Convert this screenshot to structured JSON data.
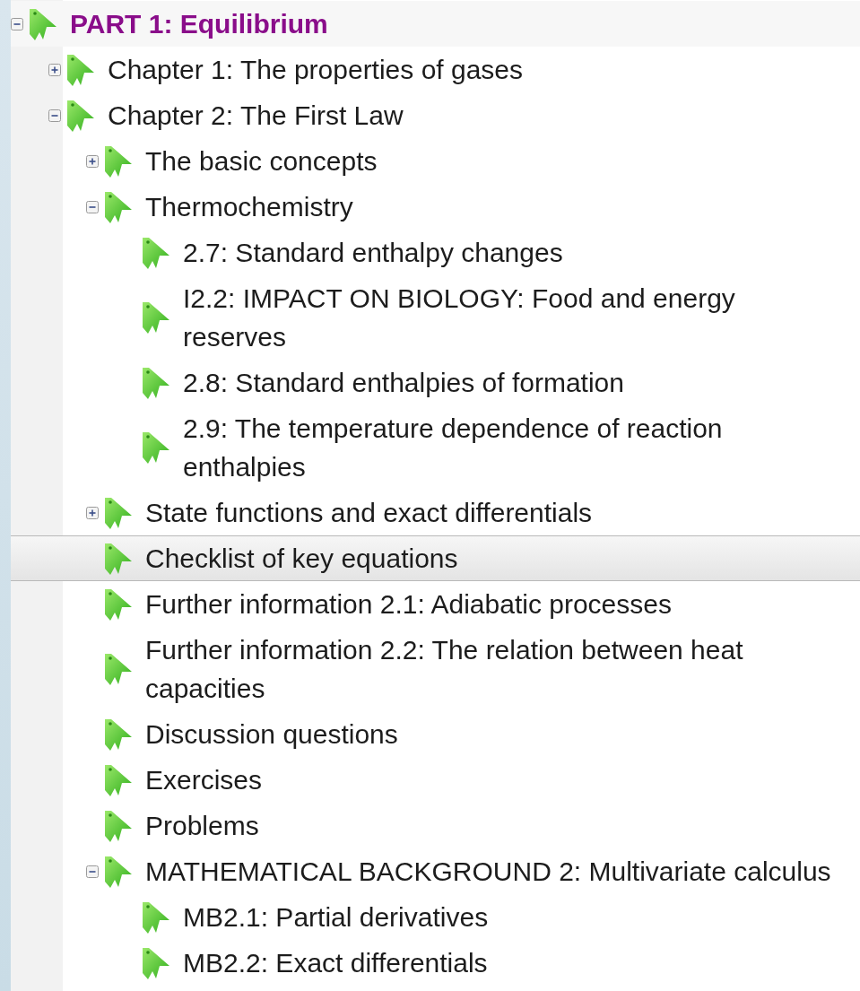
{
  "bookmarks": [
    {
      "label": "PART 1: Equilibrium",
      "kind": "part",
      "expanded": true,
      "selected": false,
      "children": [
        {
          "label": "Chapter 1: The properties of gases",
          "kind": "folder",
          "expanded": false,
          "selected": false
        },
        {
          "label": "Chapter 2: The First Law",
          "kind": "folder",
          "expanded": true,
          "selected": false,
          "children": [
            {
              "label": "The basic concepts",
              "kind": "folder",
              "expanded": false,
              "selected": false
            },
            {
              "label": "Thermochemistry",
              "kind": "folder",
              "expanded": true,
              "selected": false,
              "children": [
                {
                  "label": "2.7: Standard enthalpy changes",
                  "kind": "leaf",
                  "selected": false
                },
                {
                  "label": "I2.2: IMPACT ON BIOLOGY: Food and energy reserves",
                  "kind": "leaf",
                  "selected": false
                },
                {
                  "label": "2.8: Standard enthalpies of formation",
                  "kind": "leaf",
                  "selected": false
                },
                {
                  "label": "2.9: The temperature dependence of reaction enthalpies",
                  "kind": "leaf",
                  "selected": false
                }
              ]
            },
            {
              "label": "State functions and exact differentials",
              "kind": "folder",
              "expanded": false,
              "selected": false
            },
            {
              "label": "Checklist of key equations",
              "kind": "leaf",
              "selected": true
            },
            {
              "label": "Further information 2.1: Adiabatic processes",
              "kind": "leaf",
              "selected": false
            },
            {
              "label": "Further information 2.2: The relation between heat capacities",
              "kind": "leaf",
              "selected": false
            },
            {
              "label": "Discussion questions",
              "kind": "leaf",
              "selected": false
            },
            {
              "label": "Exercises",
              "kind": "leaf",
              "selected": false
            },
            {
              "label": "Problems",
              "kind": "leaf",
              "selected": false
            },
            {
              "label": "MATHEMATICAL BACKGROUND 2: Multivariate calculus",
              "kind": "folder",
              "expanded": true,
              "selected": false,
              "children": [
                {
                  "label": "MB2.1: Partial derivatives",
                  "kind": "leaf",
                  "selected": false
                },
                {
                  "label": "MB2.2: Exact differentials",
                  "kind": "leaf",
                  "selected": false
                }
              ]
            }
          ]
        }
      ]
    }
  ]
}
